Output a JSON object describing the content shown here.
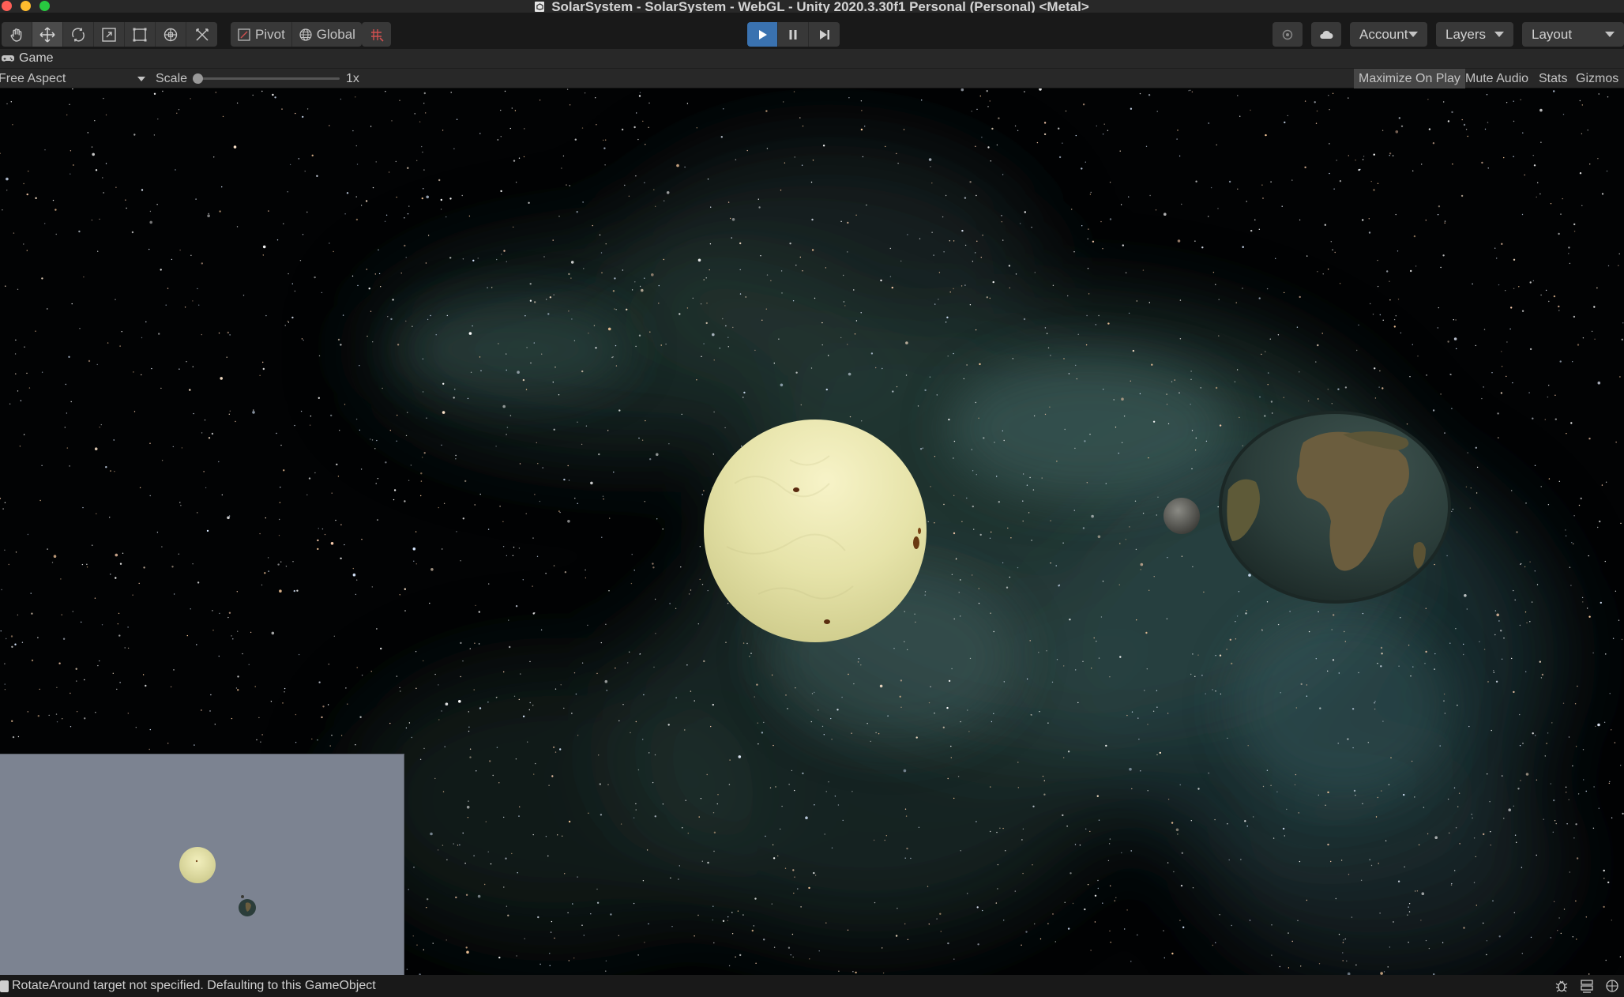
{
  "window": {
    "title": "SolarSystem - SolarSystem - WebGL - Unity 2020.3.30f1 Personal (Personal) <Metal>"
  },
  "toolbar": {
    "tools": [
      {
        "name": "hand-tool",
        "icon": "hand-icon"
      },
      {
        "name": "move-tool",
        "icon": "move-icon",
        "active": true
      },
      {
        "name": "rotate-tool",
        "icon": "rotate-icon"
      },
      {
        "name": "scale-tool",
        "icon": "scale-icon"
      },
      {
        "name": "rect-tool",
        "icon": "rect-icon"
      },
      {
        "name": "transform-tool",
        "icon": "transform-icon"
      },
      {
        "name": "custom-tool",
        "icon": "custom-tools-icon"
      }
    ],
    "pivot_label": "Pivot",
    "global_label": "Global",
    "account_label": "Account",
    "layers_label": "Layers",
    "layout_label": "Layout"
  },
  "game_tab": {
    "label": "Game",
    "aspect_label": "Free Aspect",
    "scale_label": "Scale",
    "scale_value": "1x",
    "scale_fraction": 0.0,
    "maximize_on_play_label": "Maximize On Play",
    "mute_audio_label": "Mute Audio",
    "stats_label": "Stats",
    "gizmos_label": "Gizmos"
  },
  "status": {
    "message": "RotateAround target not specified. Defaulting to this GameObject"
  },
  "colors": {
    "play_active": "#3a72b0",
    "sun": "#ebe9b0",
    "earth_ocean": "#2b3d3a",
    "minimap_bg": "#7c8391"
  }
}
